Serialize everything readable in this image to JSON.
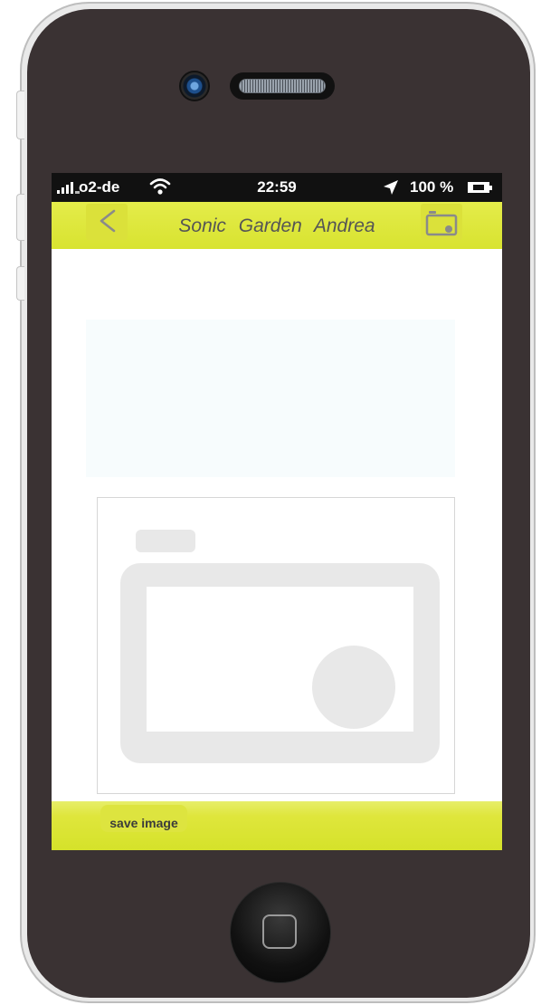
{
  "status_bar": {
    "carrier": "o2-de",
    "time": "22:59",
    "battery": "100 %",
    "signal_icon": "signal-bars-icon",
    "wifi_icon": "wifi-icon",
    "location_icon": "location-arrow-icon",
    "battery_icon": "battery-charging-icon"
  },
  "nav_bar": {
    "back_icon": "chevron-left-icon",
    "title": "Sonic Garden Andrea",
    "camera_icon": "camera-icon",
    "accent_color": "#dde43f"
  },
  "content": {
    "image_placeholder_icon": "camera-placeholder-icon"
  },
  "toolbar": {
    "save_label": "save image"
  },
  "device": {
    "home_button_icon": "home-button-icon",
    "body_color": "#3a3233"
  }
}
